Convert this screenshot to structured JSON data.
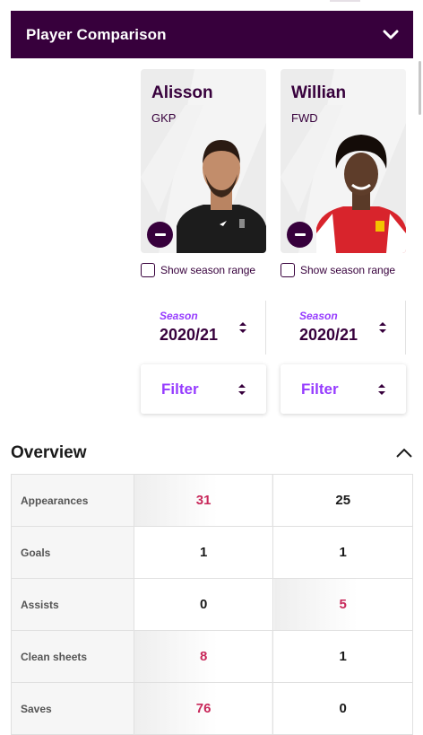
{
  "header": {
    "title": "Player Comparison"
  },
  "players": [
    {
      "name": "Alisson",
      "position": "GKP",
      "show_range_label": "Show season range",
      "season_label": "Season",
      "season_value": "2020/21",
      "filter_label": "Filter",
      "kit_color": "#1c1c1c"
    },
    {
      "name": "Willian",
      "position": "FWD",
      "show_range_label": "Show season range",
      "season_label": "Season",
      "season_value": "2020/21",
      "filter_label": "Filter",
      "kit_color": "#d8242c"
    }
  ],
  "overview": {
    "title": "Overview",
    "rows": [
      {
        "label": "Appearances",
        "p1": "31",
        "p2": "25",
        "leader": "p1"
      },
      {
        "label": "Goals",
        "p1": "1",
        "p2": "1",
        "leader": "none"
      },
      {
        "label": "Assists",
        "p1": "0",
        "p2": "5",
        "leader": "p2"
      },
      {
        "label": "Clean sheets",
        "p1": "8",
        "p2": "1",
        "leader": "p1"
      },
      {
        "label": "Saves",
        "p1": "76",
        "p2": "0",
        "leader": "p1"
      }
    ]
  },
  "colors": {
    "brand": "#37003c",
    "accent": "#963cff",
    "leader": "#c8285a"
  },
  "icons": [
    "chevron-down-icon",
    "chevron-up-icon",
    "remove-player-icon",
    "sort-arrows-icon",
    "checkbox-icon"
  ]
}
